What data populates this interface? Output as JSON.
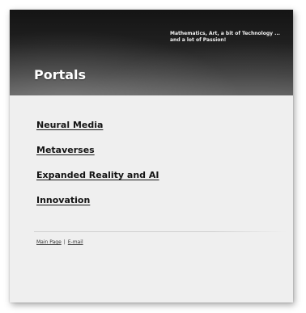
{
  "header": {
    "tagline_line1": "Mathematics, Art, a bit of Technology ...",
    "tagline_line2": "and a lot of Passion!",
    "title": "Portals"
  },
  "portals": [
    {
      "label": "Neural Media"
    },
    {
      "label": "Metaverses"
    },
    {
      "label": "Expanded Reality and AI"
    },
    {
      "label": "Innovation"
    }
  ],
  "footer": {
    "main_page": "Main Page",
    "separator": "|",
    "email": "E-mail"
  }
}
